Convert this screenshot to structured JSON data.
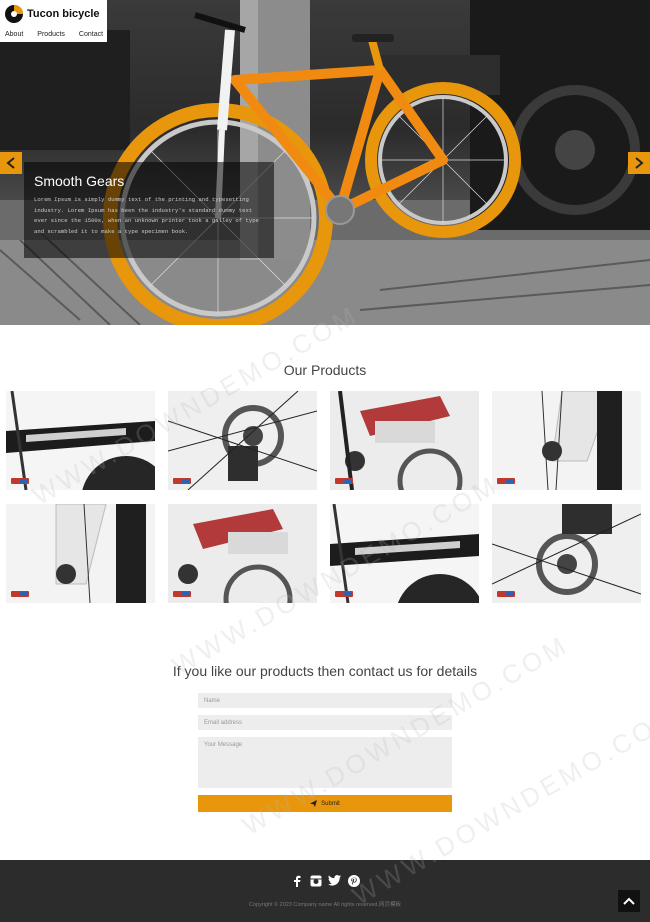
{
  "header": {
    "logo_text": "Tucon bicycle",
    "nav": [
      "About",
      "Products",
      "Contact"
    ]
  },
  "hero": {
    "caption_title": "Smooth Gears",
    "caption_text": "Lorem Ipsum is simply dummy text of the printing and typesetting industry. Lorem Ipsum has been the industry's standard dummy text ever since the 1500s, when an unknown printer took a galley of type and scrambled it to make a type specimen book.",
    "accent_color": "#e8960c"
  },
  "products": {
    "title": "Our Products"
  },
  "contact": {
    "title": "If you like our products then contact us for details",
    "name_placeholder": "Name",
    "email_placeholder": "Email address",
    "message_placeholder": "Your Message",
    "submit_label": "Submit"
  },
  "footer": {
    "social_icons": [
      "facebook-icon",
      "instagram-icon",
      "twitter-icon",
      "pinterest-icon"
    ],
    "copyright": "Copyright © 2023 Company name All rights reserved.网页模板"
  },
  "watermark": "WWW.DOWNDEMO.COM"
}
